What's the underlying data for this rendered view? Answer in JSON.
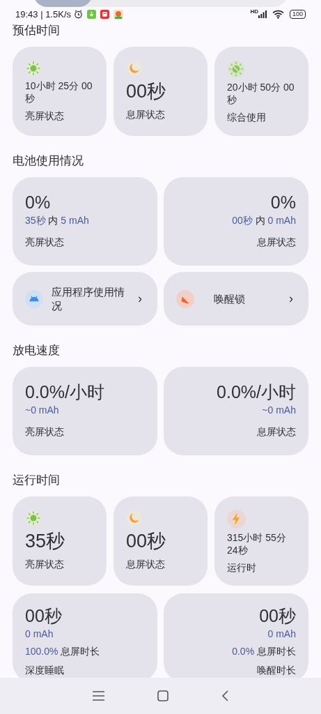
{
  "status_bar": {
    "time": "19:43 | 1.5K/s",
    "network": "HD",
    "battery": "100"
  },
  "sections": [
    {
      "title": "预估时间",
      "kind": "tiles",
      "cards": [
        {
          "value": "10小时 25分 00 秒",
          "label": "亮屏状态"
        },
        {
          "value": "00秒",
          "label": "息屏状态"
        },
        {
          "value": "20小时 50分 00 秒",
          "label": "综合使用"
        }
      ]
    },
    {
      "title": "电池使用情况",
      "kind": "usage",
      "cards": [
        {
          "value": "0%",
          "duration": "35秒",
          "within": "内",
          "amount": "5 mAh",
          "label": "亮屏状态"
        },
        {
          "value": "0%",
          "duration": "00秒",
          "within": "内",
          "amount": "0 mAh",
          "label": "息屏状态"
        }
      ],
      "links": [
        {
          "label": "应用程序使用情况",
          "chevron": "›"
        },
        {
          "label": "唤醒锁",
          "chevron": "›"
        }
      ]
    },
    {
      "title": "放电速度",
      "kind": "rate",
      "cards": [
        {
          "value": "0.0%/小时",
          "amount": "~0 mAh",
          "label": "亮屏状态"
        },
        {
          "value": "0.0%/小时",
          "amount": "~0 mAh",
          "label": "息屏状态"
        }
      ]
    },
    {
      "title": "运行时间",
      "kind": "tiles",
      "cards": [
        {
          "value": "35秒",
          "label": "亮屏状态"
        },
        {
          "value": "00秒",
          "label": "息屏状态"
        },
        {
          "value": "315小时 55分 24秒",
          "label": "运行时"
        }
      ],
      "more": [
        {
          "value": "00秒",
          "amount": "0 mAh",
          "percent": "100.0%",
          "percent_label": "息屏时长",
          "label": "深度睡眠"
        },
        {
          "value": "00秒",
          "amount": "0 mAh",
          "percent": "0.0%",
          "percent_label": "息屏时长",
          "label": "唤醒时长"
        }
      ]
    }
  ]
}
